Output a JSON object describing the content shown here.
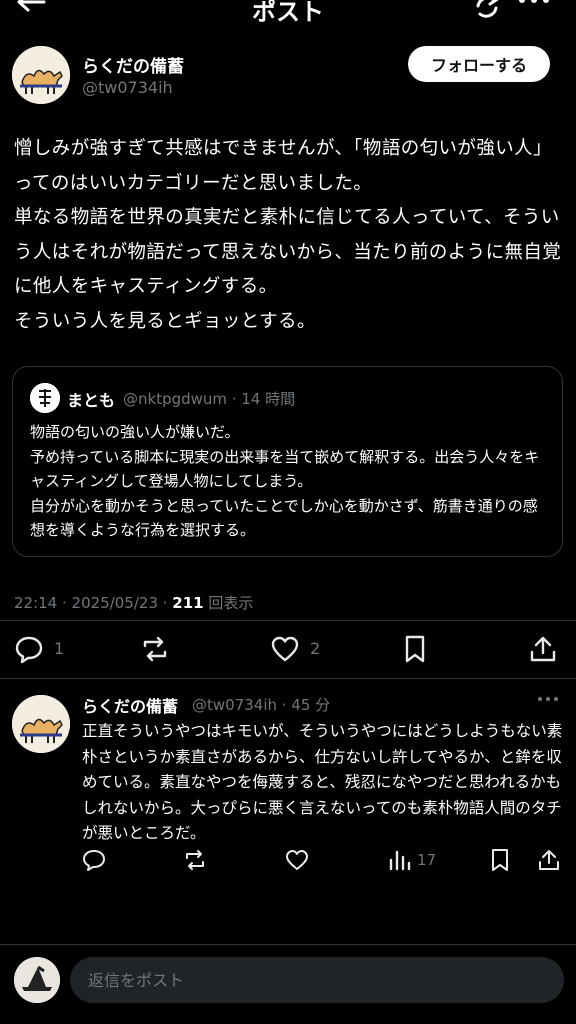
{
  "header": {
    "title": "ポスト"
  },
  "post": {
    "author_name": "らくだの備蓄",
    "author_handle": "@tw0734ih",
    "follow_label": "フォローする",
    "text": "憎しみが強すぎて共感はできませんが、「物語の匂いが強い人」ってのはいいカテゴリーだと思いました。\n単なる物語を世界の真実だと素朴に信じてる人っていて、そういう人はそれが物語だって思えないから、当たり前のように無自覚に他人をキャスティングする。\nそういう人を見るとギョッとする。",
    "quote": {
      "name": "まとも",
      "meta": "@nktpgdwum · 14 時間",
      "text": "物語の匂いの強い人が嫌いだ。\n予め持っている脚本に現実の出来事を当て嵌めて解釈する。出会う人々をキャスティングして登場人物にしてしまう。\n自分が心を動かそうと思っていたことでしか心を動かさず、筋書き通りの感想を導くような行為を選択する。"
    },
    "time": "22:14 · 2025/05/23 · ",
    "views": "211",
    "views_label": " 回表示",
    "stats": {
      "replies": "1",
      "likes": "2"
    }
  },
  "reply": {
    "name": "らくだの備蓄",
    "meta": "@tw0734ih · 45 分",
    "text": "正直そういうやつはキモいが、そういうやつにはどうしようもない素朴さというか素直さがあるから、仕方ないし許してやるか、と鉾を収めている。素直なやつを侮蔑すると、残忍になやつだと思われるかもしれないから。大っぴらに悪く言えないってのも素朴物語人間のタチが悪いところだ。",
    "views": "17"
  },
  "composer": {
    "placeholder": "返信をポスト"
  },
  "colors": {
    "background": "#000000",
    "secondary_text": "#71767b",
    "divider": "#2f3336"
  }
}
